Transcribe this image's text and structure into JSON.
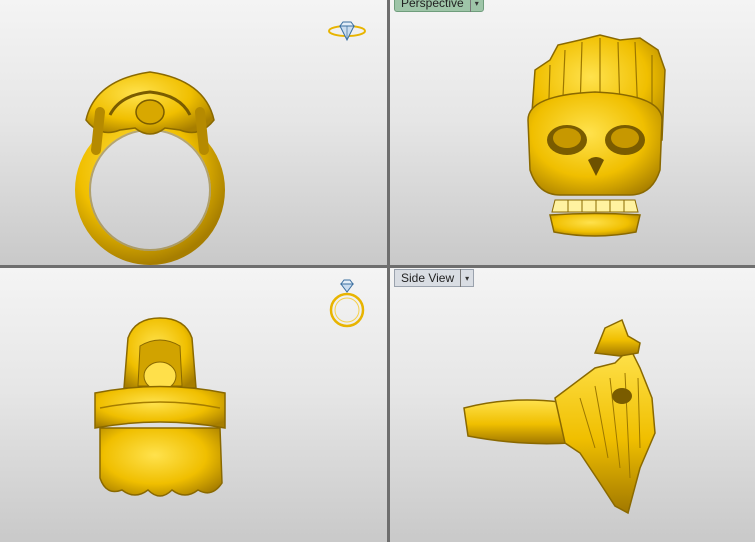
{
  "viewports": {
    "top_left": {
      "name": "",
      "content": "ring-top-view"
    },
    "top_right": {
      "name": "Perspective",
      "content": "skull-perspective-view"
    },
    "bottom_left": {
      "name": "",
      "content": "ring-front-view"
    },
    "bottom_right": {
      "name": "Side View",
      "content": "ring-side-view"
    }
  },
  "dropdown_arrow": "▾",
  "icons": {
    "view_gizmo_top": "diamond-ring-icon",
    "view_gizmo_front": "ring-front-icon"
  },
  "colors": {
    "model_gold": "#f2c200",
    "model_shadow": "#a57d00",
    "perspective_tab": "#9ec5a8",
    "side_tab": "#d9dde3"
  }
}
